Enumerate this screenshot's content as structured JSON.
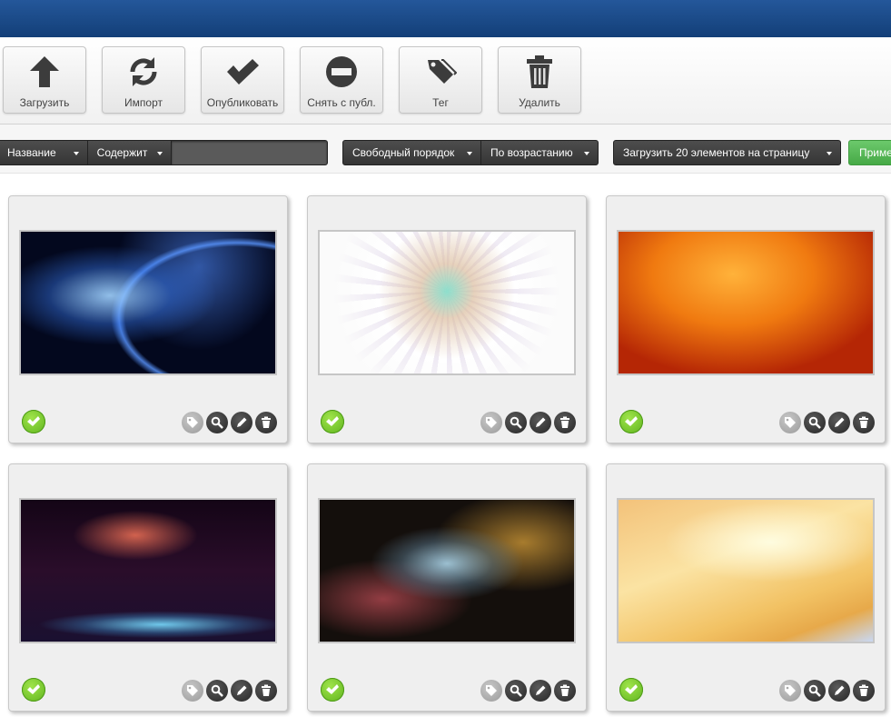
{
  "toolbar": {
    "buttons": [
      {
        "label": "Загрузить",
        "icon": "upload-arrow-icon"
      },
      {
        "label": "Импорт",
        "icon": "refresh-icon"
      },
      {
        "label": "Опубликовать",
        "icon": "checkmark-icon"
      },
      {
        "label": "Снять с публ.",
        "icon": "minus-circle-icon"
      },
      {
        "label": "Тег",
        "icon": "tags-icon"
      },
      {
        "label": "Удалить",
        "icon": "trash-icon"
      }
    ]
  },
  "filters": {
    "field": "Название",
    "condition": "Содержит",
    "search_value": "",
    "order": "Свободный порядок",
    "direction": "По возрастанию",
    "per_page": "Загрузить 20 элементов на страницу",
    "apply_label": "Применить"
  },
  "colors": {
    "header": "#1b4a88",
    "published": "#6cc92a",
    "apply": "#5bbb5b"
  },
  "items": [
    {
      "status": "published",
      "status_icon": "check-circle-icon"
    },
    {
      "status": "published",
      "status_icon": "check-circle-icon"
    },
    {
      "status": "published",
      "status_icon": "check-circle-icon"
    },
    {
      "status": "published",
      "status_icon": "check-circle-icon"
    },
    {
      "status": "published",
      "status_icon": "check-circle-icon"
    },
    {
      "status": "published",
      "status_icon": "check-circle-icon"
    }
  ]
}
